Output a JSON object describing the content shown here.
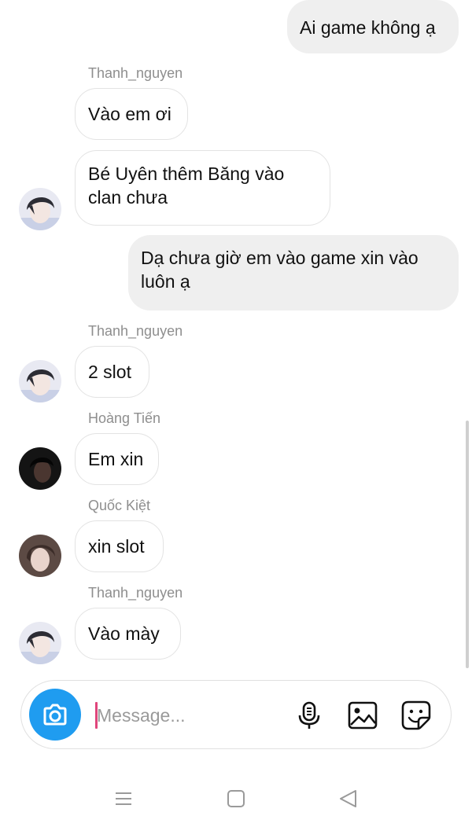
{
  "messages": [
    {
      "id": "m1",
      "side": "out",
      "text": "Ai game không ạ"
    },
    {
      "id": "m2",
      "side": "in",
      "sender": "Thanh_nguyen",
      "text": "Vào em ơi"
    },
    {
      "id": "m3",
      "side": "in",
      "text": "Bé Uyên thêm Băng vào clan chưa"
    },
    {
      "id": "m4",
      "side": "out",
      "text": "Dạ chưa giờ em vào game xin vào luôn ạ"
    },
    {
      "id": "m5",
      "side": "in",
      "sender": "Thanh_nguyen",
      "text": "2 slot"
    },
    {
      "id": "m6",
      "side": "in",
      "sender": "Hoàng Tiến",
      "text": "Em xin"
    },
    {
      "id": "m7",
      "side": "in",
      "sender": "Quốc Kiệt",
      "text": "xin slot"
    },
    {
      "id": "m8",
      "side": "in",
      "sender": "Thanh_nguyen",
      "text": "Vào mày"
    }
  ],
  "composer": {
    "placeholder": "Message...",
    "icons": [
      "camera-icon",
      "microphone-icon",
      "gallery-icon",
      "sticker-icon"
    ]
  },
  "navbar": {
    "icons": [
      "menu-icon",
      "home-icon",
      "back-icon"
    ]
  },
  "colors": {
    "camera_button": "#1f9cf0",
    "bubble_out": "#efefef",
    "bubble_in_border": "#e3e3e3",
    "cursor": "#e0457b"
  }
}
